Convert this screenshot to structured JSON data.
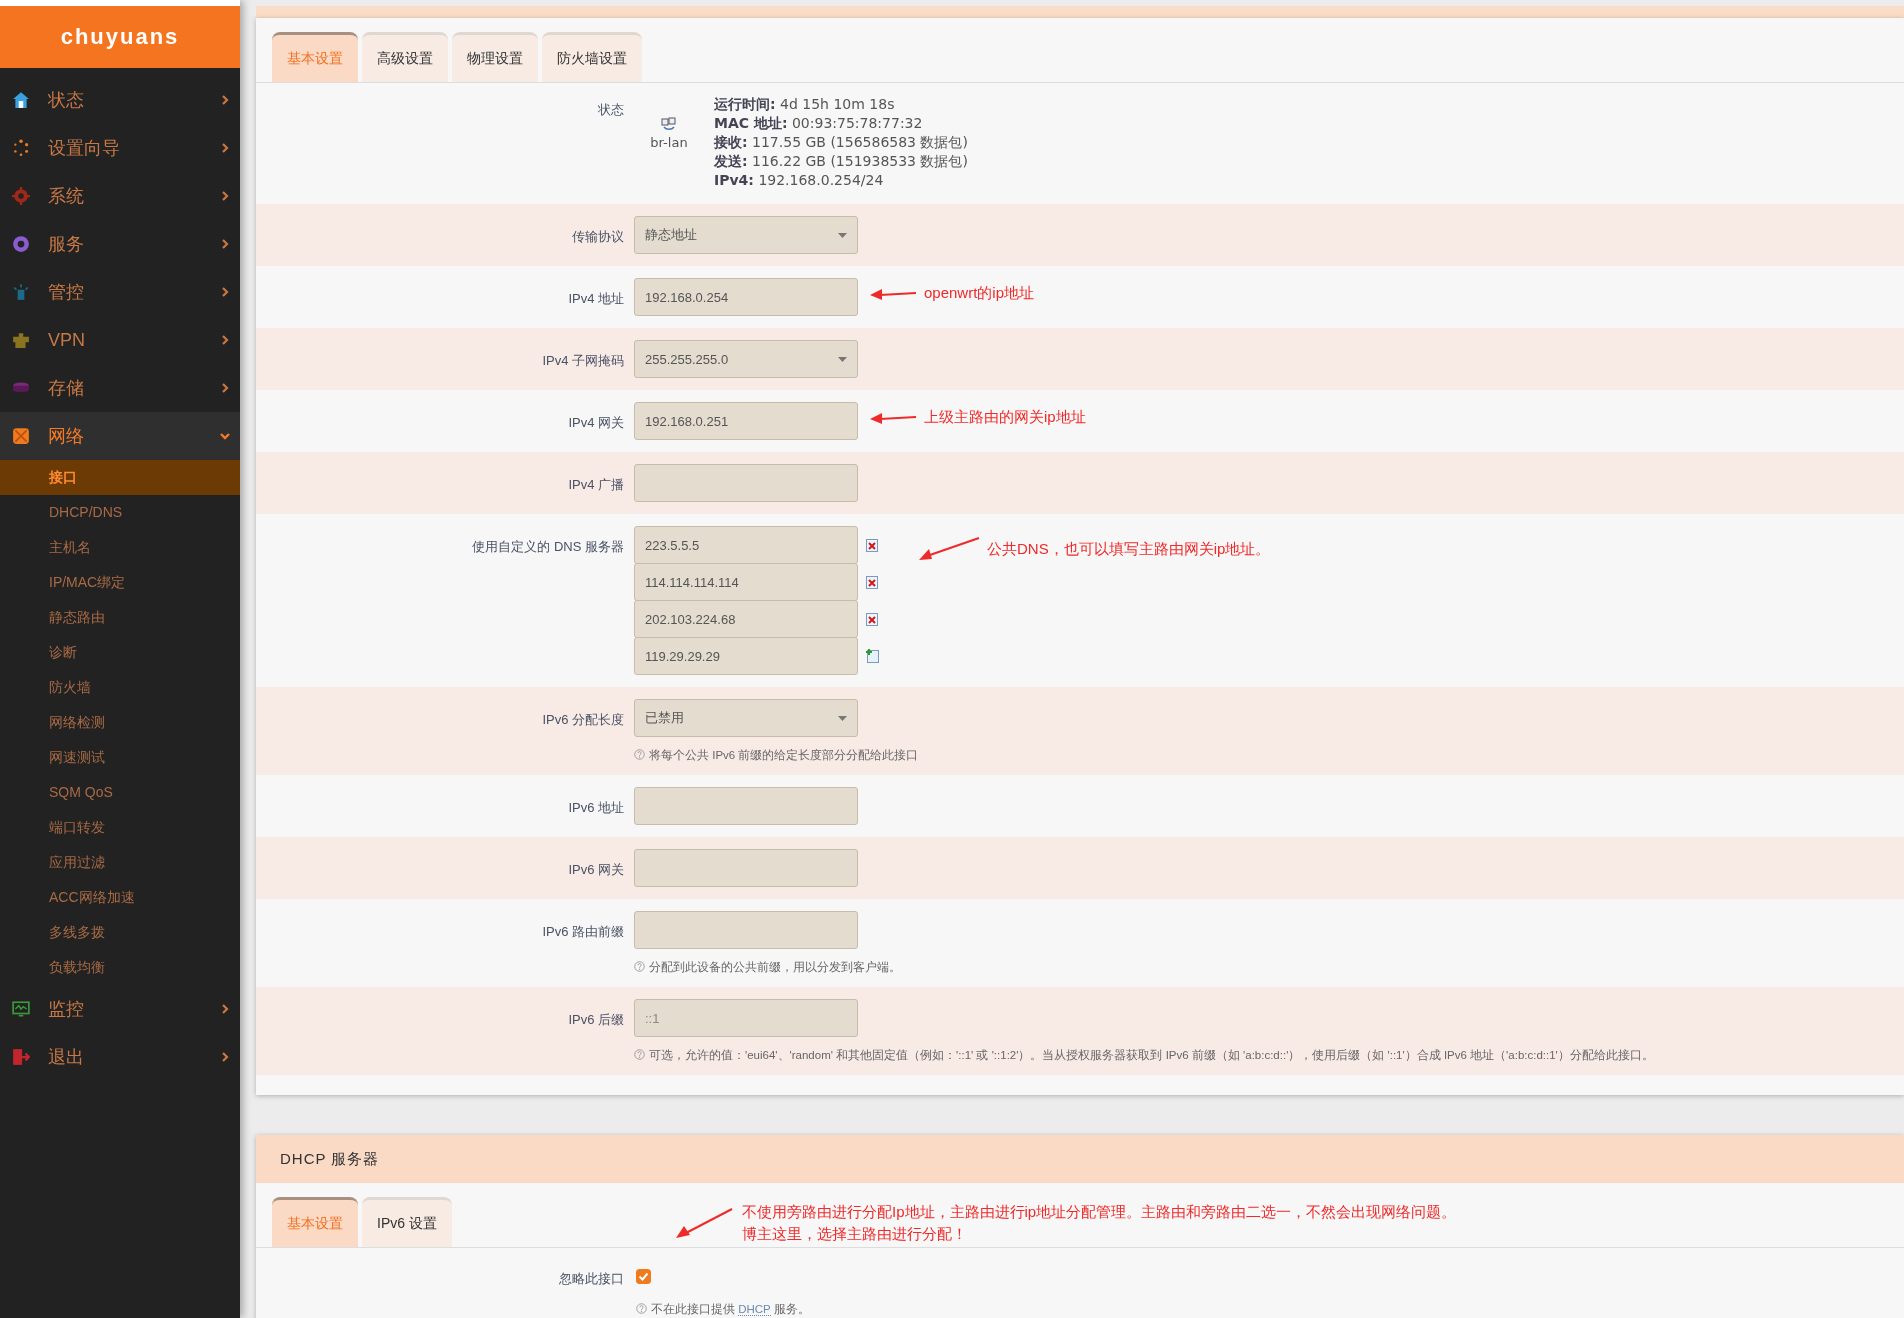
{
  "sidebar": {
    "logo": "chuyuans",
    "items": [
      {
        "label": "状态",
        "expanded": false
      },
      {
        "label": "设置向导",
        "expanded": false
      },
      {
        "label": "系统",
        "expanded": false
      },
      {
        "label": "服务",
        "expanded": false
      },
      {
        "label": "管控",
        "expanded": false
      },
      {
        "label": "VPN",
        "expanded": false
      },
      {
        "label": "存储",
        "expanded": false
      },
      {
        "label": "网络",
        "expanded": true,
        "children": [
          {
            "label": "接口",
            "selected": true
          },
          {
            "label": "DHCP/DNS",
            "selected": false
          },
          {
            "label": "主机名",
            "selected": false
          },
          {
            "label": "IP/MAC绑定",
            "selected": false
          },
          {
            "label": "静态路由",
            "selected": false
          },
          {
            "label": "诊断",
            "selected": false
          },
          {
            "label": "防火墙",
            "selected": false
          },
          {
            "label": "网络检测",
            "selected": false
          },
          {
            "label": "网速测试",
            "selected": false
          },
          {
            "label": "SQM QoS",
            "selected": false
          },
          {
            "label": "端口转发",
            "selected": false
          },
          {
            "label": "应用过滤",
            "selected": false
          },
          {
            "label": "ACC网络加速",
            "selected": false
          },
          {
            "label": "多线多拨",
            "selected": false
          },
          {
            "label": "负载均衡",
            "selected": false
          }
        ]
      },
      {
        "label": "监控",
        "expanded": false
      },
      {
        "label": "退出",
        "expanded": false
      }
    ]
  },
  "tabs": [
    {
      "label": "基本设置",
      "selected": true
    },
    {
      "label": "高级设置",
      "selected": false
    },
    {
      "label": "物理设置",
      "selected": false
    },
    {
      "label": "防火墙设置",
      "selected": false
    }
  ],
  "status": {
    "label": "状态",
    "device": "br-lan",
    "lines": [
      "**运行时间:** 4d 15h 10m 18s",
      "**MAC 地址:** 00:93:75:78:77:32",
      "**接收:** 117.55 GB (156586583 数据包)",
      "**发送:** 116.22 GB (151938533 数据包)",
      "**IPv4:** 192.168.0.254/24"
    ]
  },
  "fields": [
    {
      "kind": "select",
      "label": "传输协议",
      "value": "静态地址"
    },
    {
      "kind": "text",
      "label": "IPv4 地址",
      "value": "192.168.0.254",
      "annotation": "openwrt的ip地址"
    },
    {
      "kind": "select",
      "label": "IPv4 子网掩码",
      "value": "255.255.255.0"
    },
    {
      "kind": "text",
      "label": "IPv4 网关",
      "value": "192.168.0.251",
      "annotation": "上级主路由的网关ip地址"
    },
    {
      "kind": "text",
      "label": "IPv4 广播"
    },
    {
      "kind": "list",
      "label": "使用自定义的 DNS 服务器",
      "entries": [
        {
          "value": "223.5.5.5",
          "kind": "remove"
        },
        {
          "value": "114.114.114.114",
          "kind": "remove"
        },
        {
          "value": "202.103.224.68",
          "kind": "remove"
        },
        {
          "value": "119.29.29.29",
          "kind": "add"
        }
      ],
      "annotation": "公共DNS，也可以填写主路由网关ip地址。"
    },
    {
      "kind": "select",
      "label": "IPv6 分配长度",
      "value": "已禁用",
      "hint": "将每个公共 IPv6 前缀的给定长度部分分配给此接口"
    },
    {
      "kind": "text",
      "label": "IPv6 地址"
    },
    {
      "kind": "text",
      "label": "IPv6 网关"
    },
    {
      "kind": "text",
      "label": "IPv6 路由前缀",
      "hint": "分配到此设备的公共前缀，用以分发到客户端。"
    },
    {
      "kind": "text",
      "label": "IPv6 后缀",
      "placeholder": "::1",
      "hint": "可选，允许的值：'eui64'、'random' 和其他固定值（例如：'::1' 或 '::1:2'）。当从授权服务器获取到 IPv6 前缀（如 'a:b:c:d::'），使用后缀（如 '::1'）合成 IPv6 地址（'a:b:c:d::1'）分配给此接口。"
    }
  ],
  "dhcp": {
    "title": "DHCP 服务器",
    "tabs": [
      {
        "label": "基本设置",
        "selected": true
      },
      {
        "label": "IPv6 设置",
        "selected": false
      }
    ],
    "option": {
      "label": "忽略此接口",
      "checked": true,
      "hint_before": "不在此接口提供 ",
      "hint_link": "DHCP",
      "hint_after": " 服务。"
    },
    "annotation": [
      "不使用旁路由进行分配Ip地址，主路由进行ip地址分配管理。主路由和旁路由二选一，不然会出现网络问题。",
      "博主这里，选择主路由进行分配！"
    ]
  }
}
